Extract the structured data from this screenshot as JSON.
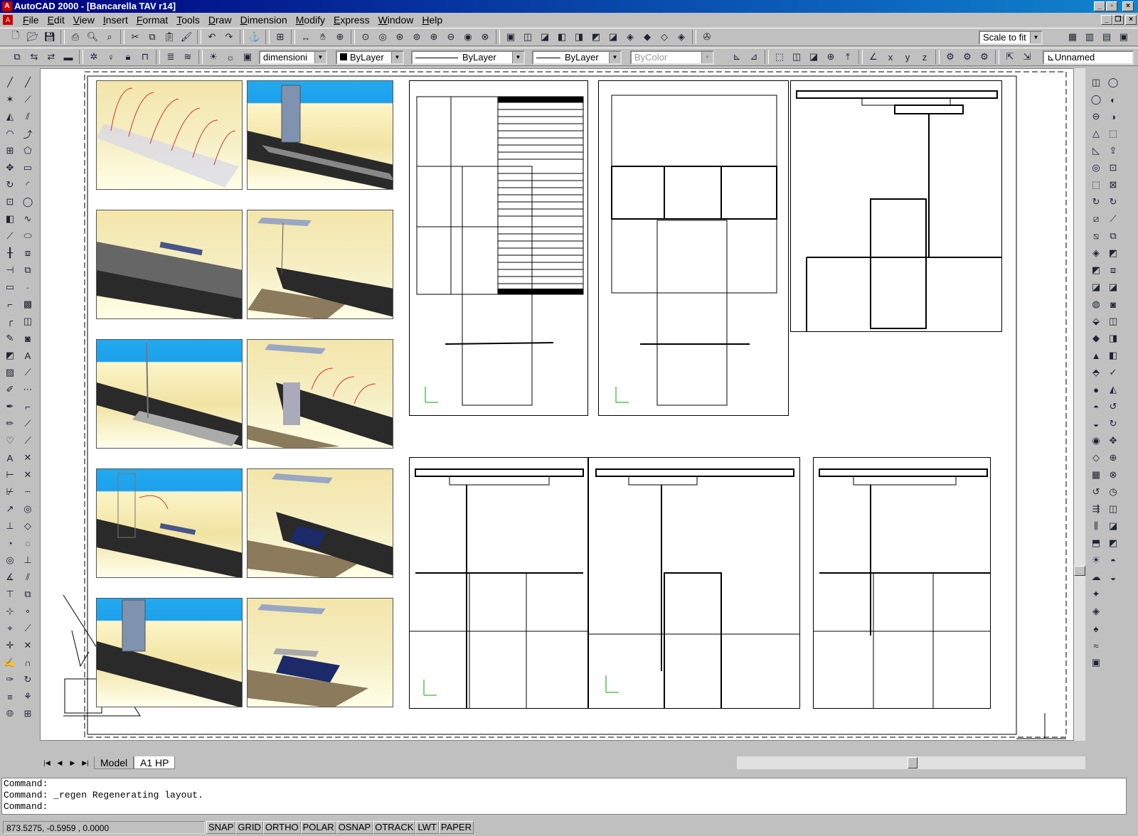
{
  "window": {
    "title": "AutoCAD 2000 - [Bancarella TAV r14]"
  },
  "menu": [
    "File",
    "Edit",
    "View",
    "Insert",
    "Format",
    "Tools",
    "Draw",
    "Dimension",
    "Modify",
    "Express",
    "Window",
    "Help"
  ],
  "toolbar": {
    "zoom_combo": "Scale to fit"
  },
  "properties": {
    "layer": "dimensioni",
    "color": "ByLayer",
    "linetype": "ByLayer",
    "lineweight": "ByLayer",
    "plotstyle": "ByColor",
    "ucs": "Unnamed"
  },
  "tabs": [
    "Model",
    "A1 HP"
  ],
  "command": {
    "lines": [
      "Command:",
      "Command: _regen Regenerating layout.",
      "Command:"
    ]
  },
  "status": {
    "coords": "873.5275, -0.5959 , 0.0000",
    "buttons": [
      "SNAP",
      "GRID",
      "ORTHO",
      "POLAR",
      "OSNAP",
      "OTRACK",
      "LWT",
      "PAPER"
    ]
  },
  "icons": {
    "standard": [
      "new-icon",
      "open-icon",
      "save-icon",
      "sep",
      "print-icon",
      "preview-icon",
      "find-icon",
      "sep",
      "cut-icon",
      "copy-icon",
      "paste-icon",
      "matchprop-icon",
      "sep",
      "undo-icon",
      "redo-icon",
      "sep",
      "hyperlink-icon",
      "sep",
      "tracking-icon",
      "sep",
      "distance-icon",
      "pan-icon",
      "zoom-realtime-icon",
      "sep",
      "zoom-window-icon",
      "zoom-dynamic-icon",
      "zoom-scale-icon",
      "zoom-center-icon",
      "zoom-in-icon",
      "zoom-out-icon",
      "zoom-all-icon",
      "zoom-extents-icon",
      "sep",
      "named-views-icon",
      "view-top-icon",
      "view-bottom-icon",
      "view-left-icon",
      "view-right-icon",
      "view-front-icon",
      "view-back-icon",
      "view-sw-icon",
      "view-se-icon",
      "view-ne-icon",
      "view-nw-icon",
      "sep",
      "camera-icon"
    ]
  }
}
